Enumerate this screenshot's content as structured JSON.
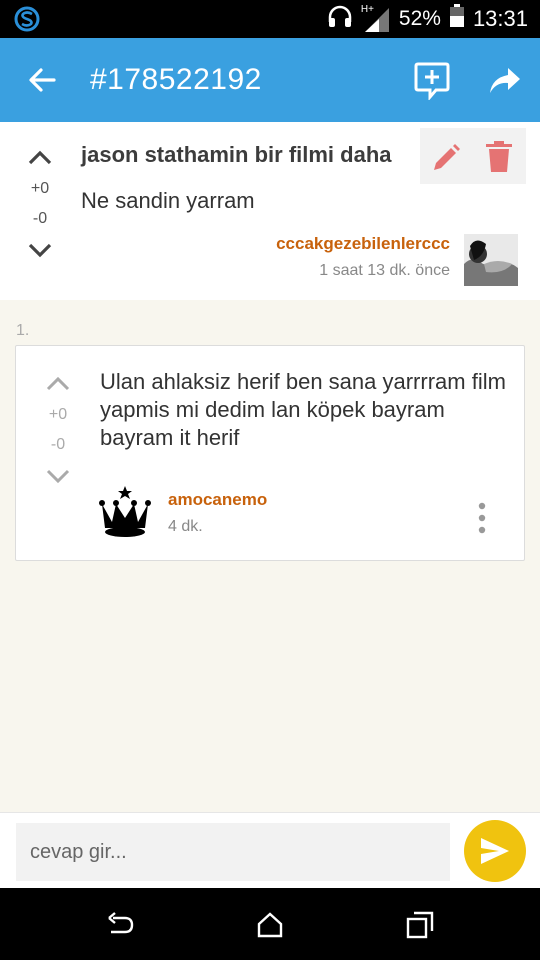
{
  "status_bar": {
    "network": "H+",
    "battery": "52%",
    "time": "13:31",
    "icons": [
      "app-s-icon",
      "headphones-icon",
      "signal-icon",
      "battery-icon"
    ]
  },
  "app_bar": {
    "title": "#178522192",
    "icons": [
      "back-arrow-icon",
      "add-comment-icon",
      "share-icon"
    ]
  },
  "entry": {
    "topic": "jason stathamin bir filmi daha",
    "content": "Ne sandin yarram",
    "upvotes": "+0",
    "downvotes": "-0",
    "author": "cccakgezebilenlerccc",
    "time": "1 saat 13 dk. önce",
    "accent_color": "#c8620c",
    "edit_color": "#e57373"
  },
  "replies": [
    {
      "index": "1.",
      "text": "Ulan ahlaksiz herif ben sana yarrrram film yapmis mi dedim lan köpek bayram bayram it herif",
      "upvotes": "+0",
      "downvotes": "-0",
      "author": "amocanemo",
      "time": "4 dk."
    }
  ],
  "input_bar": {
    "placeholder": "cevap gir...",
    "send_color": "#f0c30f"
  },
  "nav_bar": {
    "icons": [
      "back-icon",
      "home-icon",
      "recents-icon"
    ]
  },
  "colors": {
    "app_bar": "#3aa0e0",
    "background": "#f8f6ee"
  }
}
